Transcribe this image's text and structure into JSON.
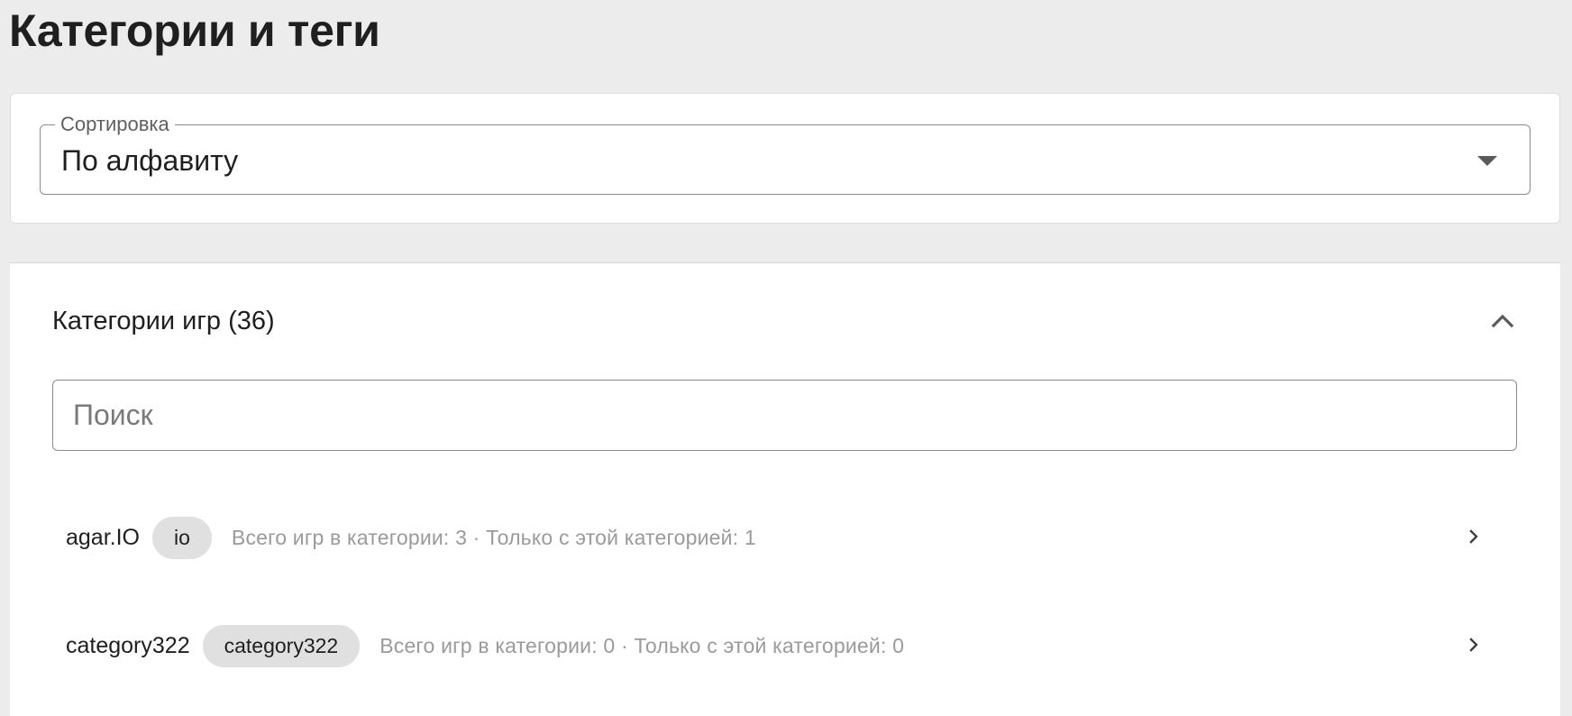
{
  "page": {
    "title": "Категории и теги"
  },
  "sort": {
    "label": "Сортировка",
    "value": "По алфавиту"
  },
  "categories": {
    "title": "Категории игр (36)",
    "search_placeholder": "Поиск",
    "rows": [
      {
        "name": "agar.IO",
        "chip": "io",
        "stats": "Всего игр в категории: 3 · Только с этой категорией: 1"
      },
      {
        "name": "category322",
        "chip": "category322",
        "stats": "Всего игр в категории: 0 · Только с этой категорией: 0"
      }
    ]
  },
  "icons": {
    "sort_dropdown": "caret-down-icon",
    "section_toggle": "chevron-up-icon",
    "row_open": "chevron-right-icon"
  },
  "colors": {
    "background": "#ececec",
    "card": "#ffffff",
    "chip": "#e0e0e0",
    "muted_text": "#9a9a9a"
  }
}
